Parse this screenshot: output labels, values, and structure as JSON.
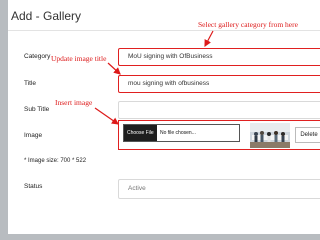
{
  "header": {
    "title": "Add - Gallery"
  },
  "form": {
    "category": {
      "label": "Category",
      "value": "MoU signing with OfBusiness"
    },
    "title": {
      "label": "Title",
      "value": "mou signing with ofbusiness"
    },
    "subtitle": {
      "label": "Sub Title",
      "value": ""
    },
    "image": {
      "label": "Image",
      "choose_label": "Choose File",
      "file_status": "No file chosen...",
      "delete_label": "Delete"
    },
    "size_note": "* Image size: 700 * 522",
    "status": {
      "label": "Status",
      "value": "Active"
    }
  },
  "annotations": {
    "category": "Select gallery category from here",
    "title": "Update image title",
    "image": "Insert image",
    "color": "#dd1a1a"
  }
}
